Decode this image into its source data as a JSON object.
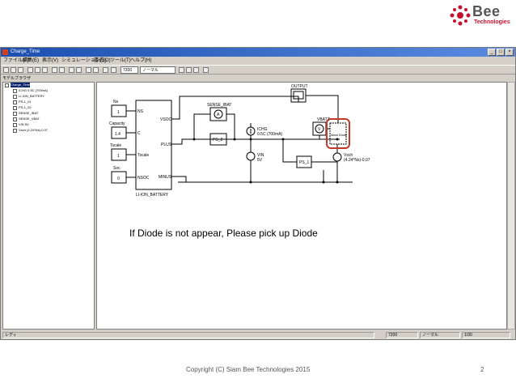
{
  "logo": {
    "name": "Bee",
    "sub": "Technologies"
  },
  "window": {
    "title": "Charge_Time",
    "controls": [
      "_",
      "□",
      "×"
    ]
  },
  "menu": [
    "ファイル(F)",
    "編集(E)",
    "表示(V)",
    "シミュレーション(S)",
    "書式(O)",
    "ツール(T)",
    "ヘルプ(H)"
  ],
  "toolbar": {
    "time_value": "7200",
    "mode_select": "ノーマル"
  },
  "model_browser": {
    "title": "モデルブラウザ",
    "items": [
      "Charge_Time",
      "ICHG 0.5C (700mA)",
      "LI-ION_BATTERY",
      "PS-1_01",
      "PS-1_02",
      "SENSE_IBAT",
      "SENSE_VBAT",
      "VIN 5V",
      "Vsch (4.24*Ns)-0.07"
    ]
  },
  "schematic": {
    "inputs": [
      {
        "label": "Ns",
        "value": "1"
      },
      {
        "label": "Capacity",
        "value": "1.4"
      },
      {
        "label": "Tscale",
        "value": "1"
      },
      {
        "label": "Soc",
        "value": "0"
      }
    ],
    "battery_pins": [
      "NS",
      "C",
      "Tscale",
      "NSOC",
      "VSOC",
      "PLUS",
      "MINUS"
    ],
    "battery_label": "LI-ION_BATTERY",
    "output_label": "OUTPUT",
    "sense_ibat": "SENSE_IBAT",
    "ammeter_symbol": "A",
    "voltmeter_symbol": "V",
    "ps2": "PS_2",
    "ps1": "PS_1",
    "vbatt": "VBATT",
    "ichg_label": "ICHG",
    "ichg_value": "0.5C (700mA)",
    "vin_label": "VIN",
    "vin_value": "5V",
    "vsch_label": "Vsch",
    "vsch_value": "(4.24*Ns)-0.07",
    "ideal_diode": "Ideal Diode"
  },
  "status": {
    "left": "レディ",
    "time": "7200",
    "mode": "ノーマル",
    "page": "1/30"
  },
  "caption": "If Diode is not appear, Please pick up Diode",
  "footer": {
    "copyright": "Copyright (C) Siam Bee Technologies 2015",
    "page": "2"
  },
  "colors": {
    "title_bar": "#1b4fb0",
    "highlight": "#c0392b",
    "brand_red": "#c8102e"
  }
}
